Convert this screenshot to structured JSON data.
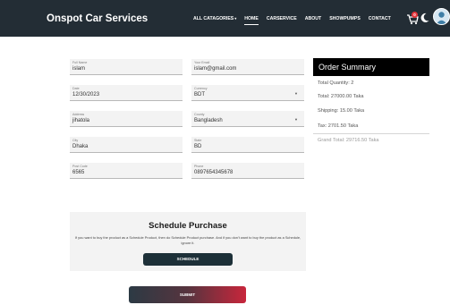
{
  "nav": {
    "brand": "Onspot Car Services",
    "links": [
      {
        "label": "ALL CATAGORIES",
        "has_caret": true
      },
      {
        "label": "HOME",
        "active": true
      },
      {
        "label": "CARSERVICE"
      },
      {
        "label": "ABOUT"
      },
      {
        "label": "SHOWPUMPS"
      },
      {
        "label": "CONTACT"
      }
    ],
    "cart_count": "0",
    "icons": [
      "cart-icon",
      "moon-icon",
      "user-avatar"
    ]
  },
  "form": {
    "full_name": {
      "label": "Full Name",
      "value": "islam"
    },
    "email": {
      "label": "Your Email",
      "value": "islam@gmail.com"
    },
    "date": {
      "label": "Date",
      "value": "12/30/2023"
    },
    "currency": {
      "label": "Currency",
      "value": "BDT"
    },
    "address": {
      "label": "Address",
      "value": "jihatola"
    },
    "country": {
      "label": "County",
      "value": "Bangladesh"
    },
    "city": {
      "label": "City",
      "value": "Dhaka"
    },
    "state": {
      "label": "State",
      "value": "BD"
    },
    "post_code": {
      "label": "Post Code",
      "value": "6565"
    },
    "phone": {
      "label": "Phone",
      "value": "0897654345678"
    }
  },
  "order_summary": {
    "title": "Order Summary",
    "total_quantity": "Total Quantity: 2",
    "total": "Total: 27000.00 Taka",
    "shipping": "Shipping: 15.00 Taka",
    "tax": "Tax: 2701.50 Taka",
    "grand_total": "Grand Total: 29716.50 Taka"
  },
  "schedule": {
    "title": "Schedule Purchase",
    "description": "If you want to buy the product as a Schedule Product, then do Schedule Product purchase. And if you don't want to buy the product as a Schedule, ignore it.",
    "button_label": "SCHEDULE"
  },
  "submit_label": "SUBMIT",
  "colors": {
    "navbar": "#232d35",
    "summary_header": "#000000",
    "schedule_button": "#1d3038",
    "submit_gradient_start": "#2c3a44",
    "submit_gradient_end": "#c8263c",
    "cart_badge": "#e5343b"
  }
}
